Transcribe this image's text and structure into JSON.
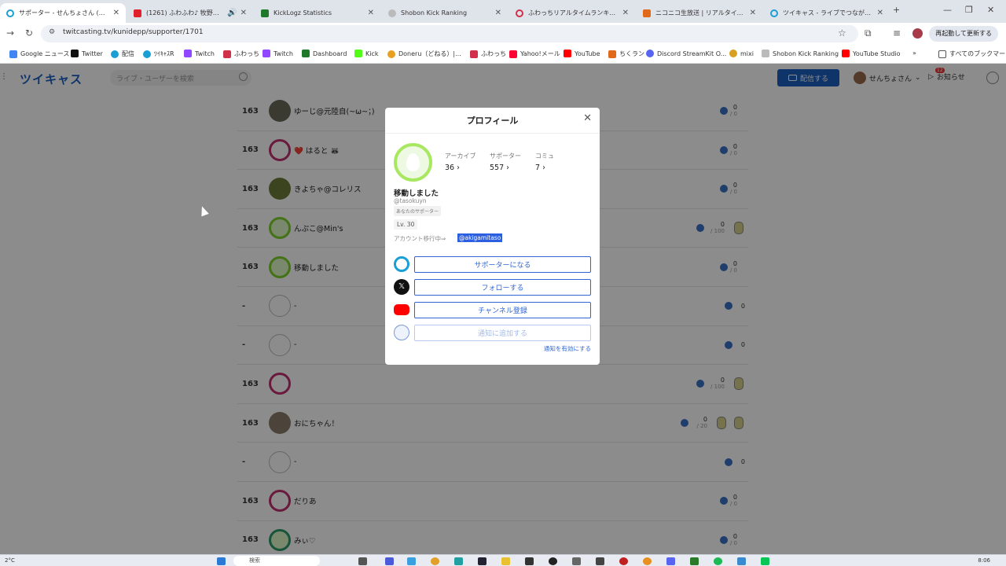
{
  "browser": {
    "tabs": [
      {
        "label": "サポーター - せんちょさん (@kunidepp)",
        "color": "#1a9fd4"
      },
      {
        "label": "(1261) ふわふわ♪ 牧野由依",
        "color": "#e0202a"
      },
      {
        "label": "KickLogz Statistics",
        "color": "#1e7a2a"
      },
      {
        "label": "Shobon Kick Ranking",
        "color": "#888888"
      },
      {
        "label": "ふわっちリアルタイムランキング | 配信",
        "color": "#d0304a"
      },
      {
        "label": "ニコニコ生放送 | リアルタイムランキ",
        "color": "#e06a1a"
      },
      {
        "label": "ツイキャス - ライブでつながるコミュニ",
        "color": "#1a9fd4"
      }
    ],
    "new_tab": "+",
    "url": "twitcasting.tv/kunidepp/supporter/1701",
    "restart_label": "再起動して更新する",
    "bookmarks": [
      {
        "label": "Google ニュース",
        "color": "#4285f4"
      },
      {
        "label": "Twitter",
        "color": "#111111"
      },
      {
        "label": "配信",
        "color": "#1a9fd4"
      },
      {
        "label": "ﾂｲｷｬｽR",
        "color": "#1a9fd4"
      },
      {
        "label": "Twitch",
        "color": "#9146ff"
      },
      {
        "label": "ふわっち",
        "color": "#d0304a"
      },
      {
        "label": "Twitch",
        "color": "#9146ff"
      },
      {
        "label": "Dashboard",
        "color": "#1e7a2a"
      },
      {
        "label": "Kick",
        "color": "#53fc18"
      },
      {
        "label": "Doneru（どねる）|...",
        "color": "#e8a020"
      },
      {
        "label": "ふわっち",
        "color": "#d0304a"
      },
      {
        "label": "Yahoo!メール",
        "color": "#ff0033"
      },
      {
        "label": "YouTube",
        "color": "#ff0000"
      },
      {
        "label": "ちくラン",
        "color": "#e06a1a"
      },
      {
        "label": "Discord StreamKit O...",
        "color": "#5865f2"
      },
      {
        "label": "mixi",
        "color": "#d8a020"
      },
      {
        "label": "Shobon Kick Ranking",
        "color": "#888888"
      },
      {
        "label": "YouTube Studio",
        "color": "#ff0000"
      }
    ],
    "bookmarks_more": "»",
    "all_bookmarks": "すべてのブックマーク"
  },
  "site": {
    "logo": "ツイキャス",
    "search_placeholder": "ライブ・ユーザーを検索",
    "live_button": "配信する",
    "user_name": "せんちょさん",
    "notifications_label": "お知らせ",
    "notifications_count": "12"
  },
  "supporters": [
    {
      "rank": "163",
      "name": "ゆーじ@元陸自(~ω~；)",
      "avatar": "photo",
      "points": "0",
      "sub": "/ 0"
    },
    {
      "rank": "163",
      "name": "❤️ はると 🦝",
      "avatar": "egg",
      "points": "0",
      "sub": "/ 0"
    },
    {
      "rank": "163",
      "name": "きよちゃ@コレリス",
      "avatar": "photo",
      "points": "0",
      "sub": "/ 0"
    },
    {
      "rank": "163",
      "name": "んぷこ@Min's",
      "avatar": "egg-g",
      "points": "0",
      "sub": "/ 100"
    },
    {
      "rank": "163",
      "name": "移動しました",
      "avatar": "egg-g",
      "points": "0",
      "sub": "/ 0"
    },
    {
      "rank": "-",
      "name": "-",
      "avatar": "none",
      "points": "0",
      "sub": ""
    },
    {
      "rank": "-",
      "name": "-",
      "avatar": "none",
      "points": "0",
      "sub": ""
    },
    {
      "rank": "163",
      "name": "",
      "avatar": "egg",
      "points": "0",
      "sub": "/ 100"
    },
    {
      "rank": "163",
      "name": "おにちゃん！",
      "avatar": "photo",
      "points": "0",
      "sub": "/ 20"
    },
    {
      "rank": "-",
      "name": "-",
      "avatar": "none",
      "points": "0",
      "sub": ""
    },
    {
      "rank": "163",
      "name": "だりあ",
      "avatar": "egg",
      "points": "0",
      "sub": "/ 0"
    },
    {
      "rank": "163",
      "name": "みぃ♡",
      "avatar": "egg-g",
      "points": "0",
      "sub": "/ 0"
    }
  ],
  "profile": {
    "title": "プロフィール",
    "close": "✕",
    "archive_label": "アーカイブ",
    "archive_value": "36 ›",
    "supporter_label": "サポーター",
    "supporter_value": "557 ›",
    "community_label": "コミュ",
    "community_value": "7 ›",
    "name": "移動しました",
    "id": "@tasokuyn",
    "tag": "あなたのサポーター",
    "level": "Lv. 30",
    "moving_label": "アカウント移行中⇒",
    "moving_link": "@akigamitaso",
    "support_button": "サポーターになる",
    "follow_button": "フォローする",
    "channel_button": "チャンネル登録",
    "notify_button": "通知に追加する",
    "notify_link": "通知を有効にする"
  },
  "taskbar": {
    "weather": "2°C",
    "search": "検索",
    "time": "8:06"
  }
}
